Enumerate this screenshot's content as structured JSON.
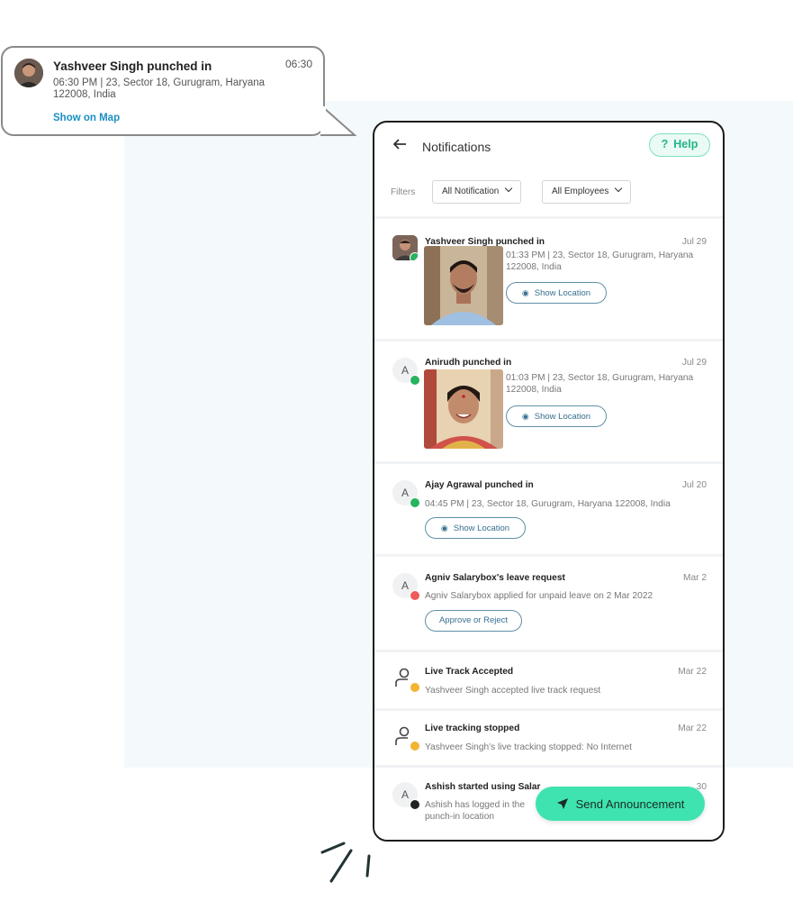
{
  "bubble": {
    "title": "Yashveer Singh punched in",
    "time": "06:30",
    "address": "06:30 PM  | 23, Sector 18, Gurugram, Haryana 122008, India",
    "link": "Show on Map"
  },
  "header": {
    "back_icon": "arrow-left-icon",
    "title": "Notifications",
    "help_label": "Help",
    "help_icon": "?"
  },
  "filters": {
    "label": "Filters",
    "notification": "All Notification",
    "employees": "All Employees"
  },
  "notifications": [
    {
      "title": "Yashveer Singh punched in",
      "date": "Jul 29",
      "desc": "01:33 PM | 23, Sector 18, Gurugram, Haryana 122008, India",
      "action": "Show Location",
      "avatar": "photo"
    },
    {
      "title": "Anirudh punched in",
      "date": "Jul 29",
      "desc": "01:03 PM | 23, Sector 18, Gurugram, Haryana 122008, India",
      "action": "Show Location",
      "avatar": "A"
    },
    {
      "title": "Ajay Agrawal punched in",
      "date": "Jul 20",
      "desc": "04:45 PM | 23, Sector 18, Gurugram, Haryana 122008, India",
      "action": "Show Location",
      "avatar": "A"
    },
    {
      "title": "Agniv Salarybox's leave request",
      "date": "Mar 2",
      "desc": "Agniv Salarybox applied for unpaid leave on 2 Mar 2022",
      "action": "Approve or Reject",
      "avatar": "A"
    },
    {
      "title": "Live Track Accepted",
      "date": "Mar 22",
      "desc": "Yashveer Singh accepted live track request",
      "avatar": "person"
    },
    {
      "title": "Live tracking stopped",
      "date": "Mar 22",
      "desc": "Yashveer Singh's live tracking stopped: No Internet",
      "avatar": "person"
    },
    {
      "title": "Ashish started using Salar",
      "date": "…30",
      "desc": "Ashish has logged in the … punch-in location",
      "desc_line1": "Ashish has logged in the",
      "desc_line2": "punch-in location",
      "avatar": "A"
    }
  ],
  "fab": {
    "label": "Send Announcement",
    "icon": "send-icon"
  },
  "colors": {
    "accent": "#3fe3b0",
    "help": "#23b48a",
    "link": "#1a8fc1",
    "pill_border": "#5f8fa8"
  }
}
